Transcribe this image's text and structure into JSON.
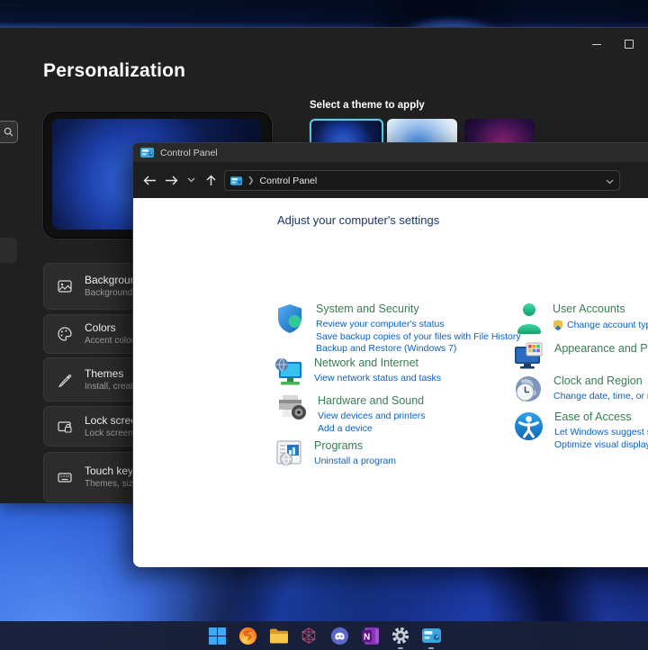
{
  "settings_window": {
    "title": "Personalization",
    "theme_section_label": "Select a theme to apply",
    "sidebar_items": [
      {
        "label": "Background",
        "sublabel": "Background i"
      },
      {
        "label": "Colors",
        "sublabel": "Accent color,"
      },
      {
        "label": "Themes",
        "sublabel": "Install, create"
      },
      {
        "label": "Lock screen",
        "sublabel": "Lock screen i"
      },
      {
        "label": "Touch keyb",
        "sublabel": "Themes, size"
      }
    ]
  },
  "control_panel": {
    "window_title": "Control Panel",
    "address_text": "Control Panel",
    "heading": "Adjust your computer's settings",
    "categories": [
      {
        "name": "System and Security",
        "links": [
          "Review your computer's status",
          "Save backup copies of your files with File History",
          "Backup and Restore (Windows 7)"
        ]
      },
      {
        "name": "Network and Internet",
        "links": [
          "View network status and tasks"
        ]
      },
      {
        "name": "Hardware and Sound",
        "links": [
          "View devices and printers",
          "Add a device"
        ]
      },
      {
        "name": "Programs",
        "links": [
          "Uninstall a program"
        ]
      },
      {
        "name": "User Accounts",
        "links": [
          "Change account type"
        ]
      },
      {
        "name": "Appearance and Personalization",
        "links": []
      },
      {
        "name": "Clock and Region",
        "links": [
          "Change date, time, or number formats"
        ]
      },
      {
        "name": "Ease of Access",
        "links": [
          "Let Windows suggest settings",
          "Optimize visual display"
        ]
      }
    ]
  },
  "taskbar": {
    "icons": [
      "start",
      "firefox",
      "file-explorer",
      "3d-wireframe-app",
      "discord",
      "onenote",
      "settings",
      "control-panel"
    ],
    "running_indicators": [
      "settings",
      "control-panel"
    ]
  },
  "colors": {
    "category_heading_green": "#3a7d54",
    "link_blue": "#0a61c2",
    "cp_heading_navy": "#17325f",
    "selected_theme_border": "#67ccdf",
    "taskbar_bg": "#191f37",
    "window_bg_dark": "#202020"
  }
}
